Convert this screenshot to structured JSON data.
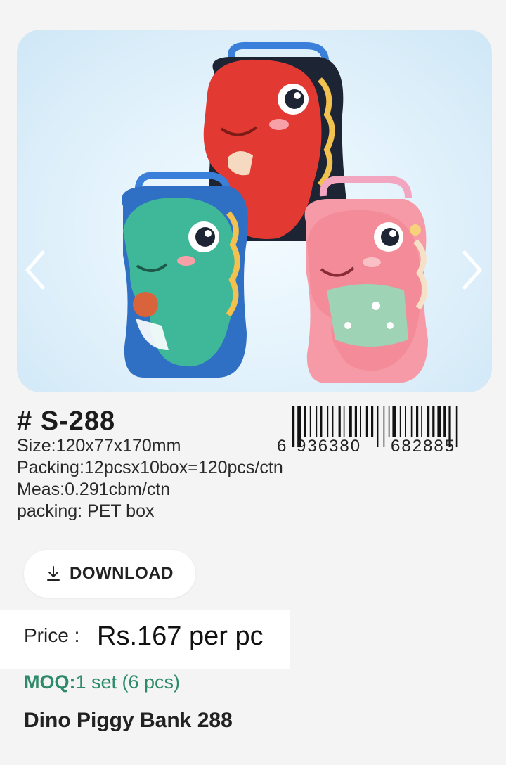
{
  "gallery": {
    "image_alt": "Dinosaur piggy bank tins",
    "prev_icon": "chevron-left-icon",
    "next_icon": "chevron-right-icon"
  },
  "product": {
    "code": "# S-288",
    "size": "Size:120x77x170mm",
    "packing": "Packing:12pcsx10box=120pcs/ctn",
    "meas": "Meas:0.291cbm/ctn",
    "packing_type": "packing: PET box",
    "barcode": {
      "first_digit": "6",
      "left_group": "936380",
      "right_group": "682885"
    }
  },
  "download": {
    "label": "DOWNLOAD",
    "icon": "download-icon"
  },
  "price": {
    "label": "Price :",
    "value": "Rs.167 per pc"
  },
  "moq": {
    "label": "MOQ:",
    "value": "1 set (6 pcs)"
  },
  "name": "Dino Piggy Bank 288",
  "colors": {
    "moq_green": "#2e8b6a",
    "dino_red": "#e23a33",
    "dino_green": "#3fb89a",
    "dino_pink": "#f38c98",
    "tin_blue": "#2f6fc4",
    "tin_navy": "#1d2433"
  }
}
